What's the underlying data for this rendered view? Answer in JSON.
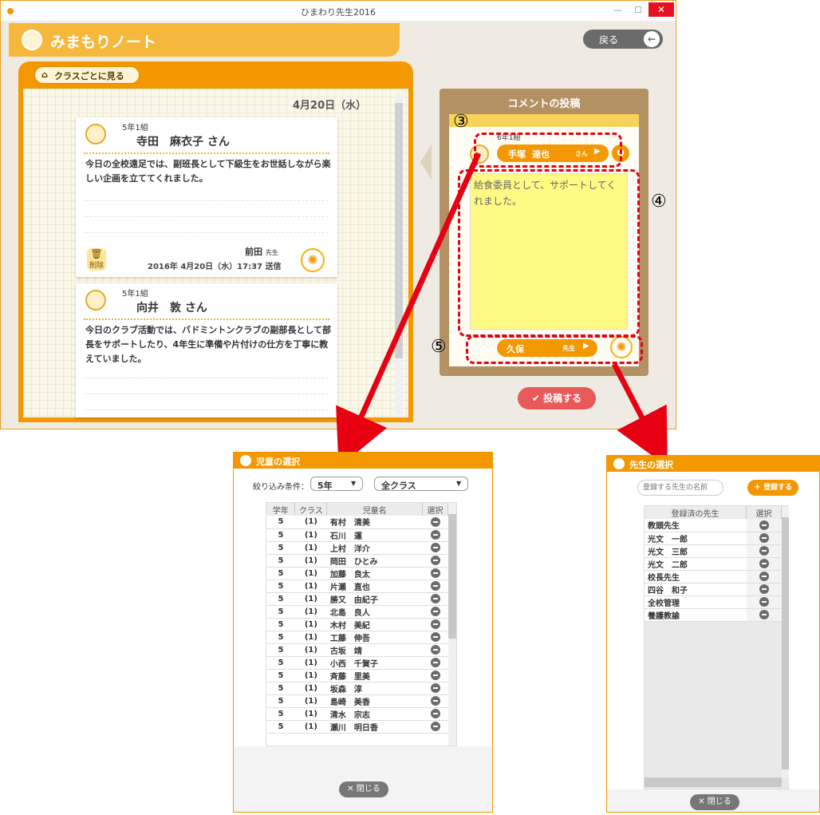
{
  "window": {
    "title": "ひまわり先生2016"
  },
  "header": {
    "title": "みまもりノート",
    "back_label": "戻る"
  },
  "left_panel": {
    "filter_button": "クラスごとに見る",
    "date": "4月20日（水）",
    "cards": [
      {
        "class": "5年1組",
        "name": "寺田　麻衣子 さん",
        "message": "今日の全校遠足では、副班長として下級生をお世話しながら楽しい企画を立ててくれました。",
        "teacher": "前田",
        "teacher_suffix": "先生",
        "sent": "2016年 4月20日（水）17:37 送信",
        "delete_label": "削除"
      },
      {
        "class": "5年1組",
        "name": "向井　敦 さん",
        "message": "今日のクラブ活動では、バドミントンクラブの副部長として部長をサポートしたり、4年生に準備や片付けの仕方を丁寧に教えていました。"
      }
    ]
  },
  "comment": {
    "title": "コメントの投稿",
    "class": "6年1組",
    "student_family": "手塚",
    "student_given": "達也",
    "student_suffix": "さん",
    "text": "給食委員として、サポートしてくれました。",
    "teacher": "久保",
    "teacher_suffix": "先生",
    "post_label": "投稿する"
  },
  "annotations": {
    "n3": "③",
    "n4": "④",
    "n5": "⑤"
  },
  "student_dialog": {
    "title": "児童の選択",
    "filter_label": "絞り込み条件：",
    "grade_value": "5年",
    "class_value": "全クラス",
    "columns": [
      "学年",
      "クラス",
      "児童名",
      "選択"
    ],
    "rows": [
      [
        "5",
        "(1)",
        "有村　清美"
      ],
      [
        "5",
        "(1)",
        "石川　運"
      ],
      [
        "5",
        "(1)",
        "上村　洋介"
      ],
      [
        "5",
        "(1)",
        "岡田　ひとみ"
      ],
      [
        "5",
        "(1)",
        "加藤　良太"
      ],
      [
        "5",
        "(1)",
        "片瀬　直也"
      ],
      [
        "5",
        "(1)",
        "勝又　由紀子"
      ],
      [
        "5",
        "(1)",
        "北島　良人"
      ],
      [
        "5",
        "(1)",
        "木村　美紀"
      ],
      [
        "5",
        "(1)",
        "工藤　伸吾"
      ],
      [
        "5",
        "(1)",
        "古坂　靖"
      ],
      [
        "5",
        "(1)",
        "小西　千賀子"
      ],
      [
        "5",
        "(1)",
        "斉藤　里美"
      ],
      [
        "5",
        "(1)",
        "坂森　淳"
      ],
      [
        "5",
        "(1)",
        "島崎　美香"
      ],
      [
        "5",
        "(1)",
        "清水　宗志"
      ],
      [
        "5",
        "(1)",
        "瀬川　明日香"
      ]
    ],
    "close_label": "閉じる"
  },
  "teacher_dialog": {
    "title": "先生の選択",
    "input_placeholder": "登録する先生の名前",
    "register_label": "登録する",
    "columns": [
      "登録済の先生",
      "選択"
    ],
    "rows": [
      "教頭先生",
      "光文　一郎",
      "光文　三郎",
      "光文　二郎",
      "校長先生",
      "四谷　和子",
      "全校管理",
      "養護教諭"
    ],
    "close_label": "閉じる"
  },
  "colors": {
    "accent": "#f39800",
    "annotation": "#e60012",
    "post": "#e85a5a",
    "note": "#fffa84"
  }
}
